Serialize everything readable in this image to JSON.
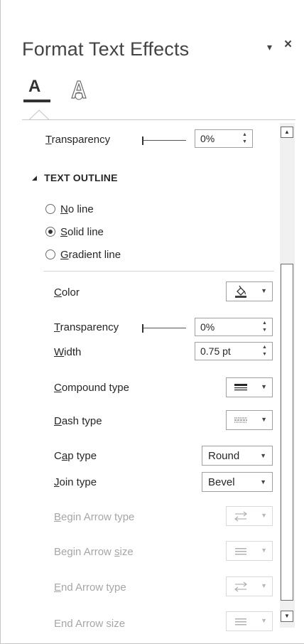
{
  "pane": {
    "title": "Format Text Effects",
    "pin_glyph": "▾",
    "close_glyph": "×",
    "tabs": [
      {
        "name": "Text Fill & Outline",
        "icon": "text-fill-outline-icon",
        "letter": "A"
      },
      {
        "name": "Text Effects",
        "icon": "text-effects-icon",
        "letter": "A"
      }
    ]
  },
  "fill": {
    "transparency_label_pre": "",
    "transparency_label_u": "T",
    "transparency_label_post": "ransparency",
    "transparency_value": "0%"
  },
  "outline": {
    "header": "TEXT OUTLINE",
    "options": [
      {
        "u": "N",
        "rest": "o line",
        "selected": false
      },
      {
        "u": "S",
        "rest": "olid line",
        "selected": true
      },
      {
        "u": "G",
        "rest": "radient line",
        "selected": false
      }
    ],
    "color_u": "C",
    "color_rest": "olor",
    "transparency_u": "T",
    "transparency_rest": "ransparency",
    "transparency_value": "0%",
    "width_u": "W",
    "width_rest": "idth",
    "width_value": "0.75 pt",
    "compound_u": "C",
    "compound_rest": "ompound type",
    "dash_u": "D",
    "dash_rest": "ash type",
    "cap_pre": "C",
    "cap_u": "a",
    "cap_rest": "p type",
    "cap_value": "Round",
    "join_u": "J",
    "join_rest": "oin type",
    "join_value": "Bevel",
    "begin_arrow_type_u": "B",
    "begin_arrow_type_rest": "egin Arrow type",
    "begin_arrow_size_pre": "Begin Arrow ",
    "begin_arrow_size_u": "s",
    "begin_arrow_size_rest": "ize",
    "end_arrow_type_u": "E",
    "end_arrow_type_rest": "nd Arrow type",
    "end_arrow_size": "End Arrow size"
  },
  "colors": {
    "text": "#262626",
    "disabled": "#a6a6a6",
    "border": "#a0a0a0",
    "line_color_swatch": "#404040"
  }
}
